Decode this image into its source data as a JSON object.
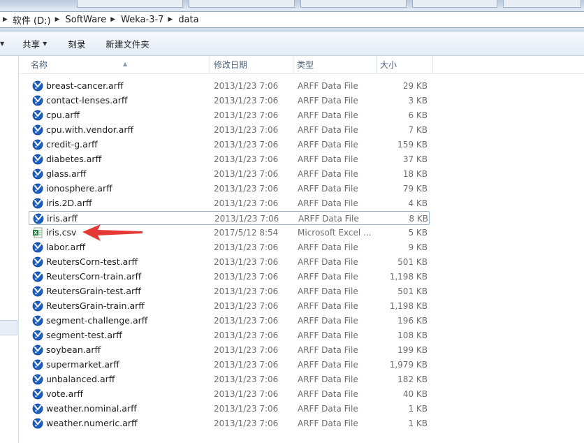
{
  "breadcrumb": [
    "软件 (D:)",
    "SoftWare",
    "Weka-3-7",
    "data"
  ],
  "toolbar": {
    "share_label": "共享",
    "burn_label": "刻录",
    "new_folder_label": "新建文件夹"
  },
  "columns": {
    "name": "名称",
    "date": "修改日期",
    "type": "类型",
    "size": "大小"
  },
  "colors": {
    "arff_icon": "#1c5fc0",
    "excel_icon": "#1f7a36",
    "annotation_arrow": "#e53935"
  },
  "files": [
    {
      "name": "breast-cancer.arff",
      "date": "2013/1/23 7:06",
      "type": "ARFF Data File",
      "size": "29 KB",
      "icon": "weka-arff-icon"
    },
    {
      "name": "contact-lenses.arff",
      "date": "2013/1/23 7:06",
      "type": "ARFF Data File",
      "size": "3 KB",
      "icon": "weka-arff-icon"
    },
    {
      "name": "cpu.arff",
      "date": "2013/1/23 7:06",
      "type": "ARFF Data File",
      "size": "6 KB",
      "icon": "weka-arff-icon"
    },
    {
      "name": "cpu.with.vendor.arff",
      "date": "2013/1/23 7:06",
      "type": "ARFF Data File",
      "size": "7 KB",
      "icon": "weka-arff-icon"
    },
    {
      "name": "credit-g.arff",
      "date": "2013/1/23 7:06",
      "type": "ARFF Data File",
      "size": "159 KB",
      "icon": "weka-arff-icon"
    },
    {
      "name": "diabetes.arff",
      "date": "2013/1/23 7:06",
      "type": "ARFF Data File",
      "size": "37 KB",
      "icon": "weka-arff-icon"
    },
    {
      "name": "glass.arff",
      "date": "2013/1/23 7:06",
      "type": "ARFF Data File",
      "size": "18 KB",
      "icon": "weka-arff-icon"
    },
    {
      "name": "ionosphere.arff",
      "date": "2013/1/23 7:06",
      "type": "ARFF Data File",
      "size": "79 KB",
      "icon": "weka-arff-icon"
    },
    {
      "name": "iris.2D.arff",
      "date": "2013/1/23 7:06",
      "type": "ARFF Data File",
      "size": "4 KB",
      "icon": "weka-arff-icon"
    },
    {
      "name": "iris.arff",
      "date": "2013/1/23 7:06",
      "type": "ARFF Data File",
      "size": "8 KB",
      "icon": "weka-arff-icon",
      "focused": true
    },
    {
      "name": "iris.csv",
      "date": "2017/5/12 8:54",
      "type": "Microsoft Excel ...",
      "size": "5 KB",
      "icon": "excel-csv-icon"
    },
    {
      "name": "labor.arff",
      "date": "2013/1/23 7:06",
      "type": "ARFF Data File",
      "size": "9 KB",
      "icon": "weka-arff-icon"
    },
    {
      "name": "ReutersCorn-test.arff",
      "date": "2013/1/23 7:06",
      "type": "ARFF Data File",
      "size": "501 KB",
      "icon": "weka-arff-icon"
    },
    {
      "name": "ReutersCorn-train.arff",
      "date": "2013/1/23 7:06",
      "type": "ARFF Data File",
      "size": "1,198 KB",
      "icon": "weka-arff-icon"
    },
    {
      "name": "ReutersGrain-test.arff",
      "date": "2013/1/23 7:06",
      "type": "ARFF Data File",
      "size": "501 KB",
      "icon": "weka-arff-icon"
    },
    {
      "name": "ReutersGrain-train.arff",
      "date": "2013/1/23 7:06",
      "type": "ARFF Data File",
      "size": "1,198 KB",
      "icon": "weka-arff-icon"
    },
    {
      "name": "segment-challenge.arff",
      "date": "2013/1/23 7:06",
      "type": "ARFF Data File",
      "size": "196 KB",
      "icon": "weka-arff-icon"
    },
    {
      "name": "segment-test.arff",
      "date": "2013/1/23 7:06",
      "type": "ARFF Data File",
      "size": "108 KB",
      "icon": "weka-arff-icon"
    },
    {
      "name": "soybean.arff",
      "date": "2013/1/23 7:06",
      "type": "ARFF Data File",
      "size": "199 KB",
      "icon": "weka-arff-icon"
    },
    {
      "name": "supermarket.arff",
      "date": "2013/1/23 7:06",
      "type": "ARFF Data File",
      "size": "1,979 KB",
      "icon": "weka-arff-icon"
    },
    {
      "name": "unbalanced.arff",
      "date": "2013/1/23 7:06",
      "type": "ARFF Data File",
      "size": "182 KB",
      "icon": "weka-arff-icon"
    },
    {
      "name": "vote.arff",
      "date": "2013/1/23 7:06",
      "type": "ARFF Data File",
      "size": "40 KB",
      "icon": "weka-arff-icon"
    },
    {
      "name": "weather.nominal.arff",
      "date": "2013/1/23 7:06",
      "type": "ARFF Data File",
      "size": "1 KB",
      "icon": "weka-arff-icon"
    },
    {
      "name": "weather.numeric.arff",
      "date": "2013/1/23 7:06",
      "type": "ARFF Data File",
      "size": "1 KB",
      "icon": "weka-arff-icon"
    }
  ]
}
